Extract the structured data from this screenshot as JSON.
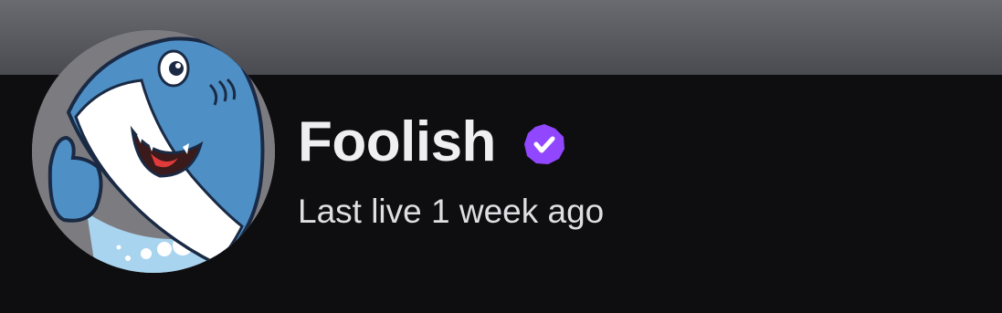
{
  "channel": {
    "name": "Foolish",
    "verified": true,
    "status_text": "Last live 1 week ago"
  },
  "colors": {
    "background": "#0e0e10",
    "banner": "#5a5b60",
    "verified_badge": "#9147ff",
    "name_text": "#efeff1",
    "status_text": "#dedee3"
  },
  "icons": {
    "verified": "verified-checkmark-icon",
    "avatar": "shark-mascot-avatar"
  }
}
